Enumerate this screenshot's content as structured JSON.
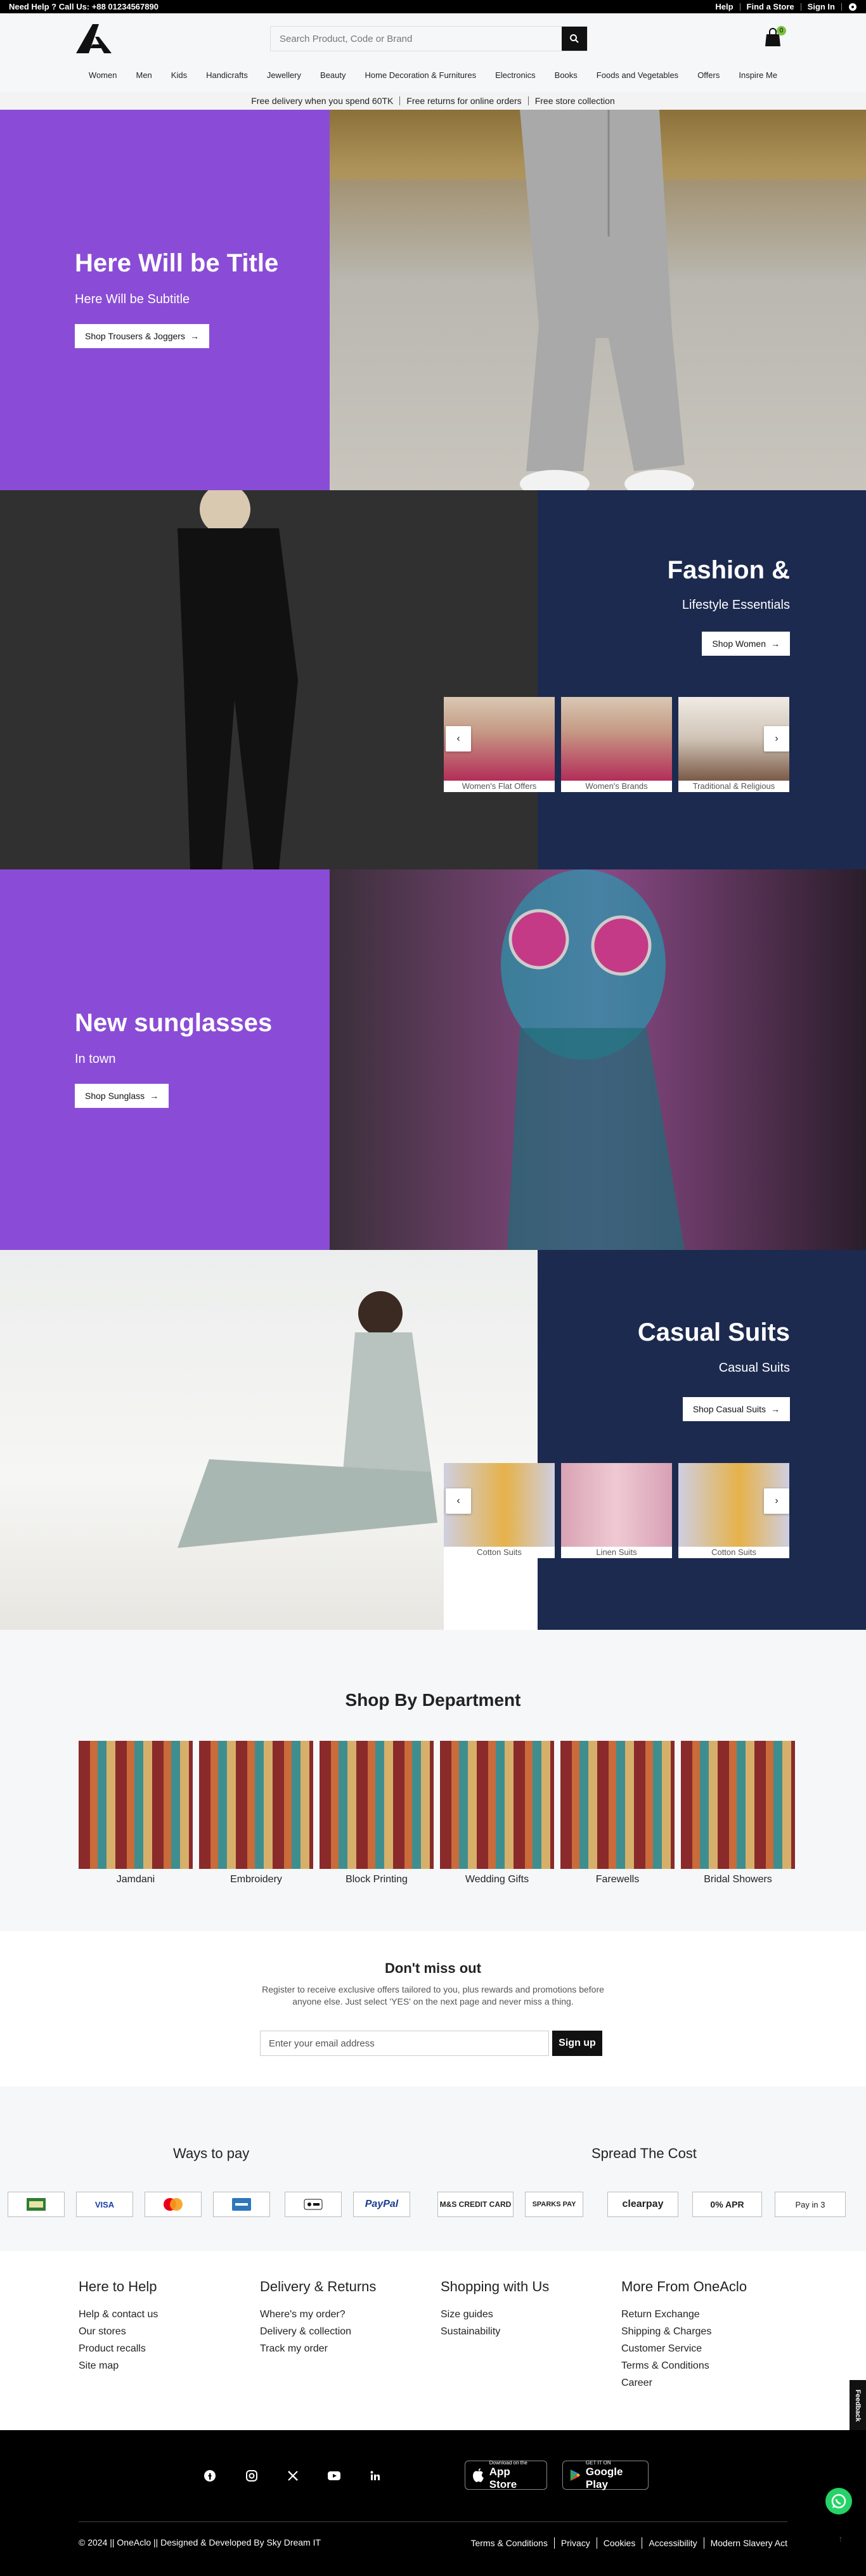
{
  "topbar": {
    "help": "Need Help ? Call Us: +88 01234567890",
    "links": [
      "Help",
      "Find a Store",
      "Sign In"
    ]
  },
  "search": {
    "placeholder": "Search Product, Code or Brand"
  },
  "cart": {
    "count": "0"
  },
  "nav": [
    "Women",
    "Men",
    "Kids",
    "Handicrafts",
    "Jewellery",
    "Beauty",
    "Home Decoration & Furnitures",
    "Electronics",
    "Books",
    "Foods and Vegetables",
    "Offers",
    "Inspire Me"
  ],
  "promo": [
    "Free delivery when you spend 60TK",
    "Free returns for online orders",
    "Free store collection"
  ],
  "hero1": {
    "title": "Here Will be Title",
    "subtitle": "Here Will be Subtitle",
    "button": "Shop Trousers & Joggers"
  },
  "hero2": {
    "title": "Fashion &",
    "subtitle": "Lifestyle Essentials",
    "button": "Shop Women",
    "cards": [
      "Women's Flat Offers",
      "Women's Brands",
      "Traditional & Religious"
    ]
  },
  "hero3": {
    "title": "New sunglasses",
    "subtitle": "In town",
    "button": "Shop Sunglass"
  },
  "hero4": {
    "title": "Casual Suits",
    "subtitle": "Casual Suits",
    "button": "Shop Casual Suits",
    "cards": [
      "Cotton Suits",
      "Linen Suits",
      "Cotton Suits"
    ]
  },
  "department": {
    "title": "Shop By Department",
    "items": [
      "Jamdani",
      "Embroidery",
      "Block Printing",
      "Wedding Gifts",
      "Farewells",
      "Bridal Showers"
    ]
  },
  "newsletter": {
    "title": "Don't miss out",
    "text": "Register to receive exclusive offers tailored to you, plus rewards and promotions before anyone else. Just select 'YES' on the next page and never miss a thing.",
    "placeholder": "Enter your email address",
    "button": "Sign up"
  },
  "pay": {
    "ways_title": "Ways to pay",
    "spread_title": "Spread The Cost",
    "ways": [
      "VISA",
      "PayPal"
    ],
    "spread": [
      "M&S CREDIT CARD",
      "SPARKS PAY",
      "clearpay",
      "0% APR",
      "Pay in 3"
    ]
  },
  "footer": {
    "cols": [
      {
        "title": "Here to Help",
        "links": [
          "Help & contact us",
          "Our stores",
          "Product recalls",
          "Site map"
        ]
      },
      {
        "title": "Delivery & Returns",
        "links": [
          "Where's my order?",
          "Delivery & collection",
          "Track my order"
        ]
      },
      {
        "title": "Shopping with Us",
        "links": [
          "Size guides",
          "Sustainability"
        ]
      },
      {
        "title": "More From OneAclo",
        "links": [
          "Return Exchange",
          "Shipping & Charges",
          "Customer Service",
          "Terms & Conditions",
          "Career"
        ]
      }
    ],
    "appstore": {
      "small": "Download on the",
      "big": "App Store"
    },
    "googleplay": {
      "small": "GET IT ON",
      "big": "Google Play"
    },
    "copyright": "© 2024 || OneAclo || Designed & Developed By Sky Dream IT",
    "links": [
      "Terms & Conditions",
      "Privacy",
      "Cookies",
      "Accessibility",
      "Modern Slavery Act"
    ],
    "feedback": "Feedback"
  },
  "colors": {
    "purple": "#8a4cd6",
    "navy": "#1c2a4f",
    "black": "#000000"
  }
}
